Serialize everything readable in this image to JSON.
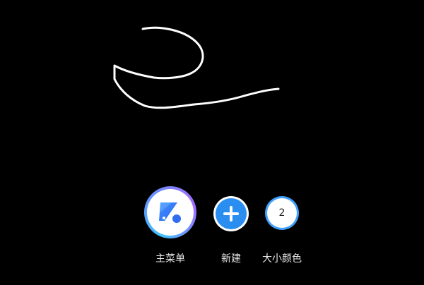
{
  "toolbar": {
    "main_menu_label": "主菜单",
    "new_label": "新建",
    "size_color_label": "大小颜色",
    "size_value": "2"
  },
  "icons": {
    "main_menu": "app-logo-icon",
    "new": "plus-icon"
  },
  "colors": {
    "background": "#000000",
    "stroke": "#ffffff",
    "accent": "#2a8df0"
  }
}
